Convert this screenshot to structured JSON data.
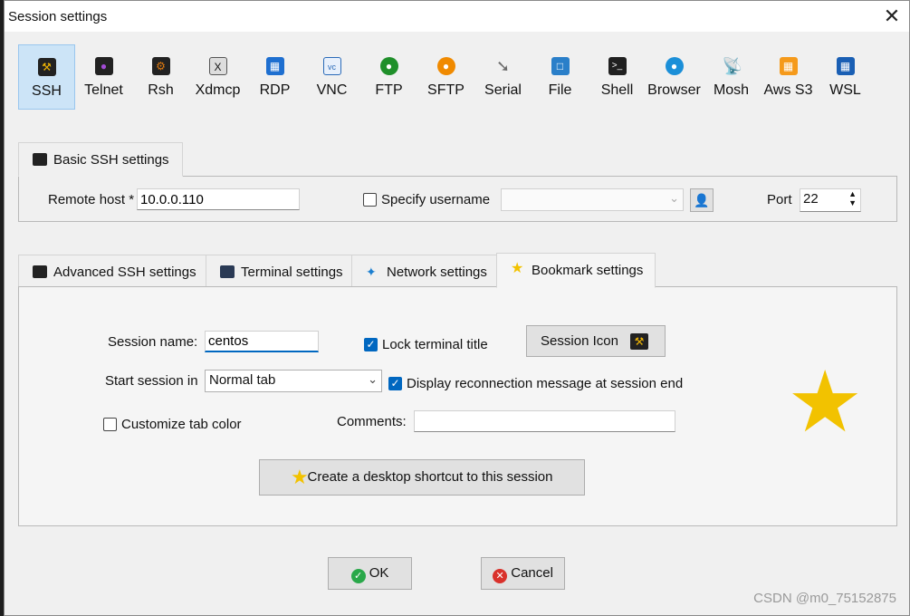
{
  "window": {
    "title": "Session settings",
    "close_glyph": "✕"
  },
  "protocols": [
    {
      "label": "SSH",
      "icon": "ssh-wrench-icon",
      "color": "#f2b705",
      "selected": true
    },
    {
      "label": "Telnet",
      "icon": "telnet-icon",
      "color": "#6a2ca0"
    },
    {
      "label": "Rsh",
      "icon": "rsh-icon",
      "color": "#e07a10"
    },
    {
      "label": "Xdmcp",
      "icon": "xdmcp-icon",
      "color": "#333333"
    },
    {
      "label": "RDP",
      "icon": "rdp-icon",
      "color": "#1e6fd0"
    },
    {
      "label": "VNC",
      "icon": "vnc-icon",
      "color": "#2a6ab8"
    },
    {
      "label": "FTP",
      "icon": "ftp-icon",
      "color": "#1f8f2a"
    },
    {
      "label": "SFTP",
      "icon": "sftp-icon",
      "color": "#f08a00"
    },
    {
      "label": "Serial",
      "icon": "serial-icon",
      "color": "#7a7a7a"
    },
    {
      "label": "File",
      "icon": "file-icon",
      "color": "#2a7fc9"
    },
    {
      "label": "Shell",
      "icon": "shell-icon",
      "color": "#202020"
    },
    {
      "label": "Browser",
      "icon": "browser-icon",
      "color": "#1b8fd8"
    },
    {
      "label": "Mosh",
      "icon": "mosh-icon",
      "color": "#2f6fc8"
    },
    {
      "label": "Aws S3",
      "icon": "aws-s3-icon",
      "color": "#f59a1b"
    },
    {
      "label": "WSL",
      "icon": "wsl-icon",
      "color": "#1a5fb4"
    }
  ],
  "basic": {
    "tab_label": "Basic SSH settings",
    "remote_host_label": "Remote host *",
    "remote_host_value": "10.0.0.110",
    "specify_username_label": "Specify username",
    "username_value": "",
    "port_label": "Port",
    "port_value": "22"
  },
  "tabs": [
    {
      "label": "Advanced SSH settings",
      "icon": "wrench-icon"
    },
    {
      "label": "Terminal settings",
      "icon": "terminal-icon"
    },
    {
      "label": "Network settings",
      "icon": "network-icon"
    },
    {
      "label": "Bookmark settings",
      "icon": "star-icon",
      "active": true
    }
  ],
  "bookmark": {
    "session_name_label": "Session name:",
    "session_name_value": "centos",
    "lock_title_label": "Lock terminal title",
    "lock_title_checked": true,
    "session_icon_label": "Session Icon",
    "start_in_label": "Start session in",
    "start_in_value": "Normal tab",
    "reconnect_label": "Display reconnection message at session end",
    "reconnect_checked": true,
    "custom_tab_color_label": "Customize tab color",
    "custom_tab_color_checked": false,
    "comments_label": "Comments:",
    "comments_value": "",
    "shortcut_label": "Create a desktop shortcut to this session"
  },
  "footer": {
    "ok_label": "OK",
    "cancel_label": "Cancel"
  },
  "colors": {
    "accent": "#0067c0",
    "star": "#f2c200",
    "ok": "#2aa84a",
    "cancel": "#d9312b"
  },
  "watermark": "CSDN @m0_75152875"
}
